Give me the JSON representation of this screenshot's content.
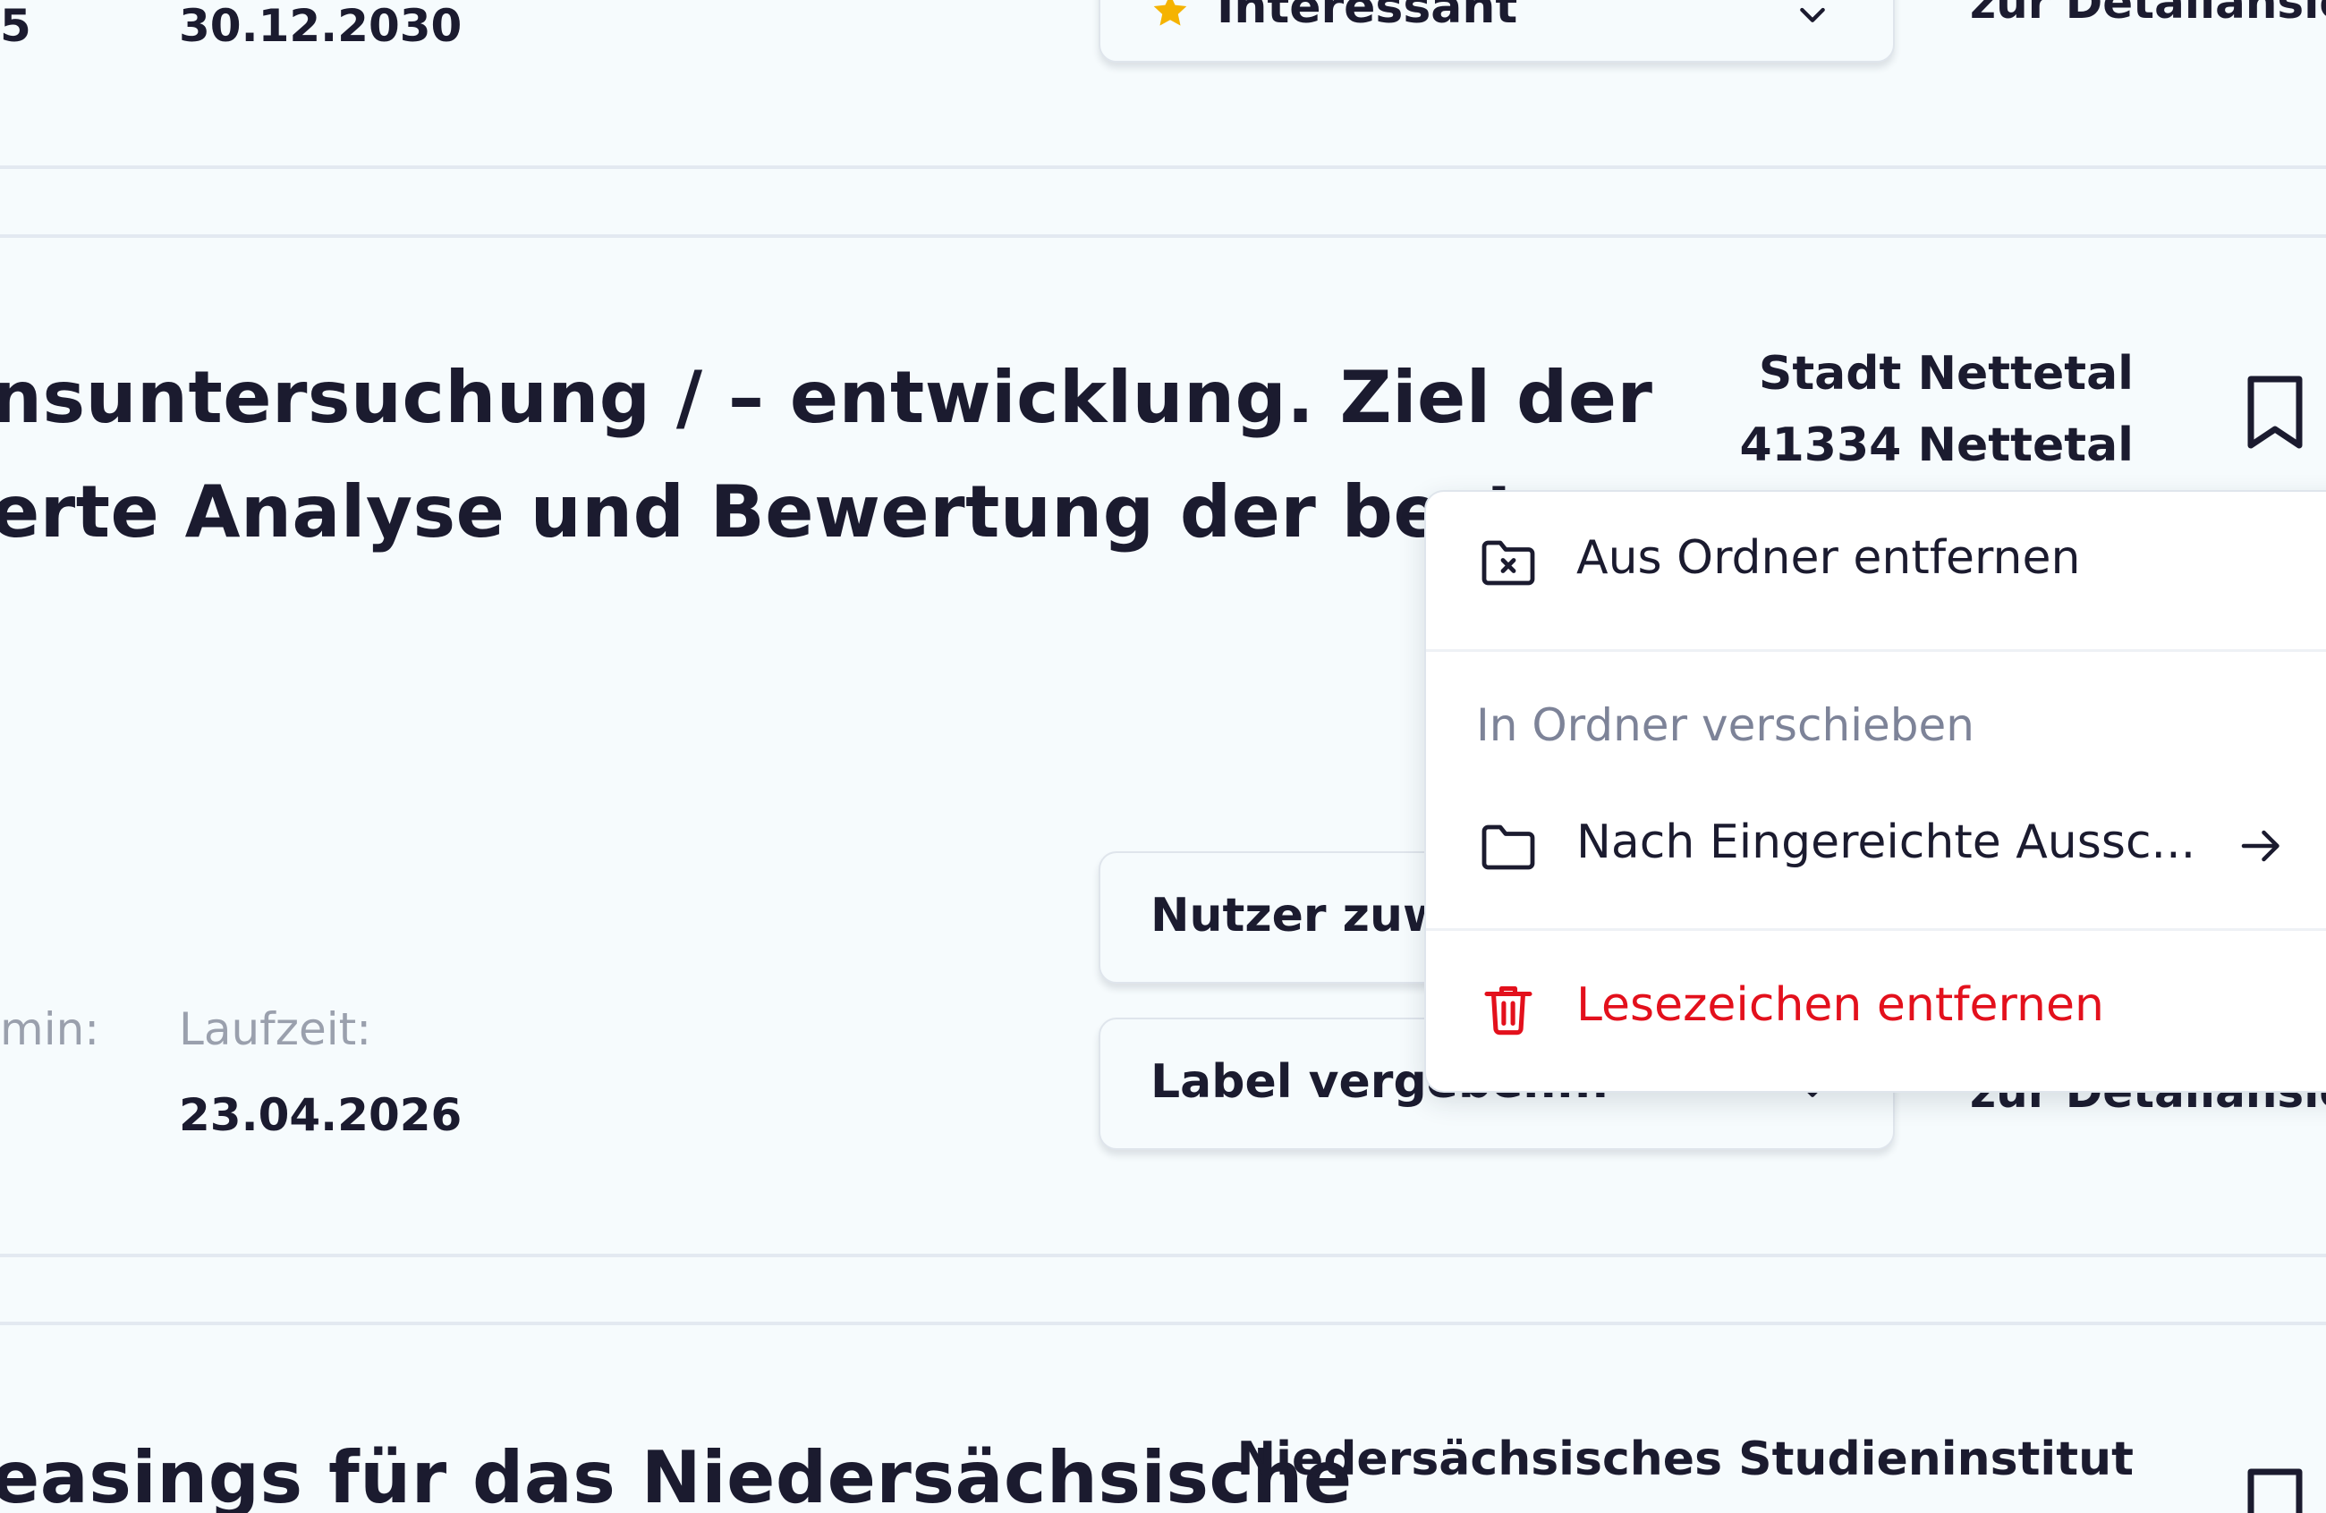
{
  "cards": {
    "top": {
      "date_value": "30.12.2030",
      "label_select": "Interessant",
      "detail_link": "zur Detailansicht",
      "left_fragment": "5"
    },
    "middle": {
      "title_line1": "nsuntersuchung / – entwicklung. Ziel der",
      "title_line2": "erte Analyse und Bewertung der best",
      "org_line1": "Stadt Nettetal",
      "org_line2": "41334 Nettetal",
      "meta_left_label": "min:",
      "meta_label": "Laufzeit:",
      "meta_value": "23.04.2026",
      "assign_select": "Nutzer zuw",
      "label_select": "Label vergeben...",
      "detail_link": "zur Detailansicht"
    },
    "bottom": {
      "title_line1": "easings für das Niedersächsische",
      "org_line1": "Niedersächsisches Studieninstitut"
    }
  },
  "menu": {
    "remove_from_folder": "Aus Ordner entfernen",
    "move_heading": "In Ordner verschieben",
    "move_target": "Nach Eingereichte Aussc...",
    "remove_bookmark": "Lesezeichen entfernen"
  },
  "colors": {
    "danger": "#e3101c",
    "text": "#1b1b2f",
    "muted": "#7d8398",
    "star": "#f5b301"
  },
  "icons": {
    "remove_folder": "folder-x-icon",
    "folder": "folder-icon",
    "arrow": "arrow-right-icon",
    "trash": "trash-icon",
    "bookmark": "bookmark-icon",
    "chevron": "chevron-down-icon",
    "star": "star-icon"
  }
}
